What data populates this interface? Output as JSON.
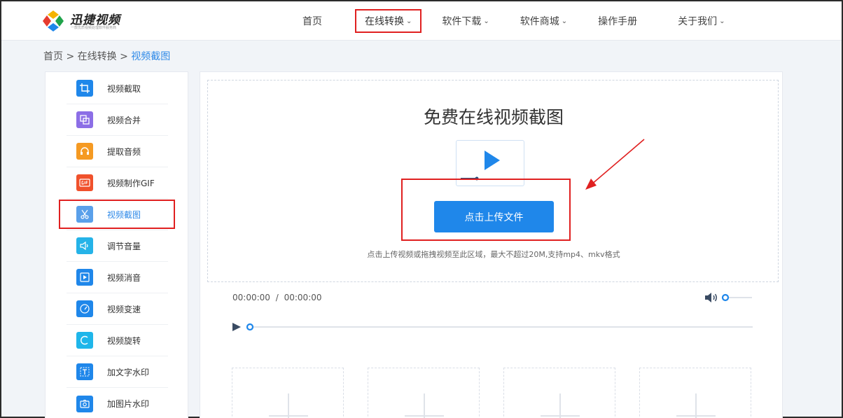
{
  "header": {
    "logo_text": "迅捷视频",
    "logo_sub": "一款优质视频处理软件服务商",
    "nav": [
      {
        "label": "首页",
        "has_dropdown": false
      },
      {
        "label": "在线转换",
        "has_dropdown": true
      },
      {
        "label": "软件下载",
        "has_dropdown": true
      },
      {
        "label": "软件商城",
        "has_dropdown": true
      },
      {
        "label": "操作手册",
        "has_dropdown": false
      },
      {
        "label": "关于我们",
        "has_dropdown": true
      }
    ]
  },
  "breadcrumb": {
    "home": "首页",
    "sep": ">",
    "section": "在线转换",
    "current": "视频截图"
  },
  "sidebar": {
    "items": [
      {
        "label": "视频截取",
        "icon": "crop-icon",
        "color": "#1f87ea"
      },
      {
        "label": "视频合并",
        "icon": "merge-icon",
        "color": "#8c6ee6"
      },
      {
        "label": "提取音频",
        "icon": "headphones-icon",
        "color": "#f59a23"
      },
      {
        "label": "视频制作GIF",
        "icon": "gif-icon",
        "color": "#f0512c"
      },
      {
        "label": "视频截图",
        "icon": "scissors-icon",
        "color": "#5aa0ea"
      },
      {
        "label": "调节音量",
        "icon": "volume-icon",
        "color": "#25b3e8"
      },
      {
        "label": "视频消音",
        "icon": "mute-video-icon",
        "color": "#1f87ea"
      },
      {
        "label": "视频变速",
        "icon": "speed-gauge-icon",
        "color": "#1f87ea"
      },
      {
        "label": "视频旋转",
        "icon": "rotate-icon",
        "color": "#1fb6ea"
      },
      {
        "label": "加文字水印",
        "icon": "text-watermark-icon",
        "color": "#1f87ea"
      },
      {
        "label": "加图片水印",
        "icon": "image-watermark-icon",
        "color": "#1f87ea"
      }
    ],
    "active_index": 4
  },
  "upload": {
    "title": "免费在线视频截图",
    "button_label": "点击上传文件",
    "hint": "点击上传视频或拖拽视频至此区域，最大不超过20M,支持mp4、mkv格式"
  },
  "player": {
    "current_time": "00:00:00",
    "separator": "/",
    "total_time": "00:00:00",
    "progress": 0,
    "volume": 0
  },
  "colors": {
    "accent": "#1f87ea",
    "annotation": "#e02020"
  }
}
